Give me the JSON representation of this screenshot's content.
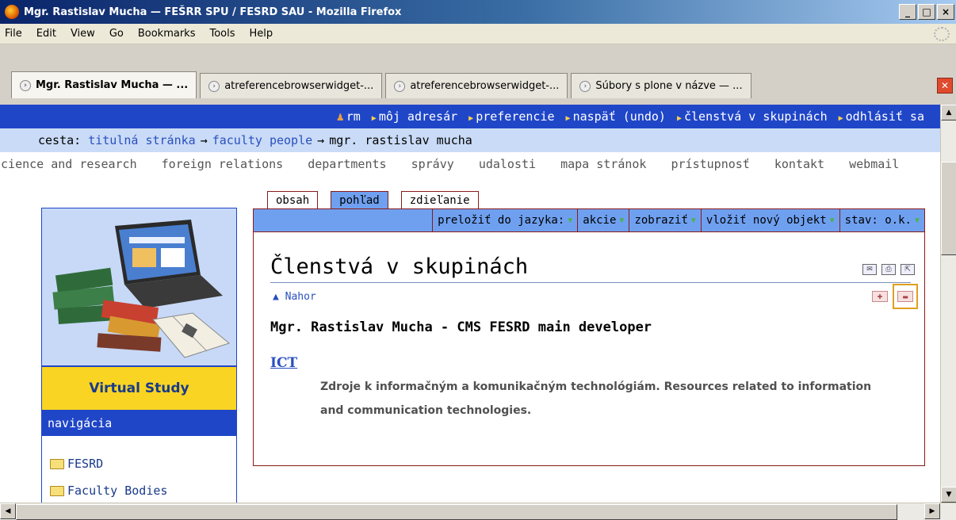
{
  "window": {
    "title": "Mgr. Rastislav Mucha — FEŠRR SPU / FESRD SAU - Mozilla Firefox"
  },
  "menu": [
    "File",
    "Edit",
    "View",
    "Go",
    "Bookmarks",
    "Tools",
    "Help"
  ],
  "tabs": [
    {
      "label": "Mgr. Rastislav Mucha — ..."
    },
    {
      "label": "atreferencebrowserwidget-..."
    },
    {
      "label": "atreferencebrowserwidget-..."
    },
    {
      "label": "Súbory s plone v názve — ..."
    }
  ],
  "userbar": {
    "user": "rm",
    "items": [
      "môj adresár",
      "preferencie",
      "naspäť (undo)",
      "členstvá v skupinách",
      "odhlásiť sa"
    ]
  },
  "breadcrumb": {
    "prefix": "cesta:",
    "items": [
      "titulná stránka",
      "faculty people"
    ],
    "current": "mgr. rastislav mucha",
    "separator": "→"
  },
  "globalnav": [
    "science and research",
    "foreign relations",
    "departments",
    "správy",
    "udalosti",
    "mapa stránok",
    "prístupnosť",
    "kontakt",
    "webmail"
  ],
  "left": {
    "virtual_study": "Virtual Study",
    "nav_heading": "navigácia",
    "nav_items": [
      "FESRD",
      "Faculty Bodies"
    ]
  },
  "content_tabs": [
    "obsah",
    "pohľad",
    "zdieľanie"
  ],
  "actions": [
    "preložiť do jazyka:",
    "akcie",
    "zobraziť",
    "vložiť nový objekt",
    "stav: o.k."
  ],
  "content": {
    "heading": "Členstvá v skupinách",
    "nahor": "Nahor",
    "member_title": "Mgr. Rastislav Mucha - CMS FESRD main developer",
    "group_link": "ICT",
    "group_desc": "Zdroje k informačným a komunikačným technológiám. Resources related to information and communication technologies."
  },
  "colors": {
    "accent": "#2046c8",
    "crumb_bg": "#c9dbf6",
    "action_bg": "#6fa0f0",
    "border": "#8a1a1a",
    "virtual_bg": "#f9d423"
  }
}
